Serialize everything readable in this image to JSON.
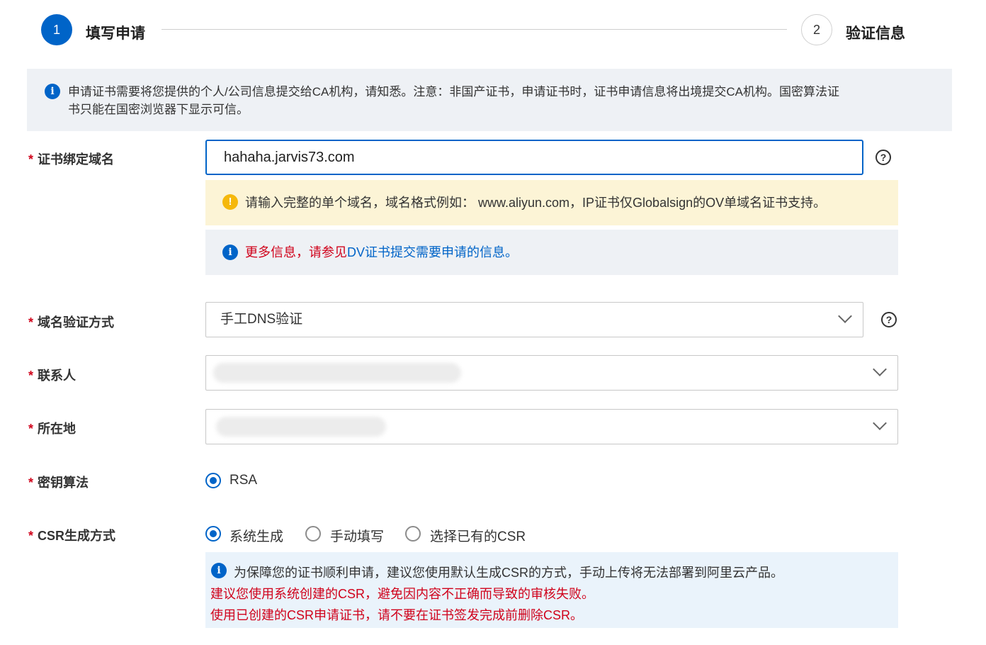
{
  "steps": [
    {
      "number": "1",
      "title": "填写申请"
    },
    {
      "number": "2",
      "title": "验证信息"
    }
  ],
  "notice": {
    "line1": "申请证书需要将您提供的个人/公司信息提交给CA机构，请知悉。注意：非国产证书，申请证书时，证书申请信息将出境提交CA机构。国密算法证",
    "line2": "书只能在国密浏览器下显示可信。"
  },
  "domain": {
    "label": "证书绑定域名",
    "value": "hahaha.jarvis73.com",
    "warning": "请输入完整的单个域名，域名格式例如： www.aliyun.com，IP证书仅Globalsign的OV单域名证书支持。",
    "info_red": "更多信息，请参见",
    "info_link": "DV证书提交需要申请的信息",
    "info_end": "。"
  },
  "verify_method": {
    "label": "域名验证方式",
    "value": "手工DNS验证"
  },
  "contact": {
    "label": "联系人"
  },
  "location": {
    "label": "所在地"
  },
  "key_algo": {
    "label": "密钥算法",
    "options": [
      "RSA"
    ]
  },
  "csr": {
    "label": "CSR生成方式",
    "options": [
      "系统生成",
      "手动填写",
      "选择已有的CSR"
    ],
    "info": "为保障您的证书顺利申请，建议您使用默认生成CSR的方式，手动上传将无法部署到阿里云产品。",
    "warn1": "建议您使用系统创建的CSR，避免因内容不正确而导致的审核失败。",
    "warn2": "使用已创建的CSR申请证书，请不要在证书签发完成前删除CSR。"
  },
  "required_mark": "*",
  "colors": {
    "primary": "#0064c8",
    "required": "#d0021b",
    "warning_bg": "#fcf4d6"
  }
}
